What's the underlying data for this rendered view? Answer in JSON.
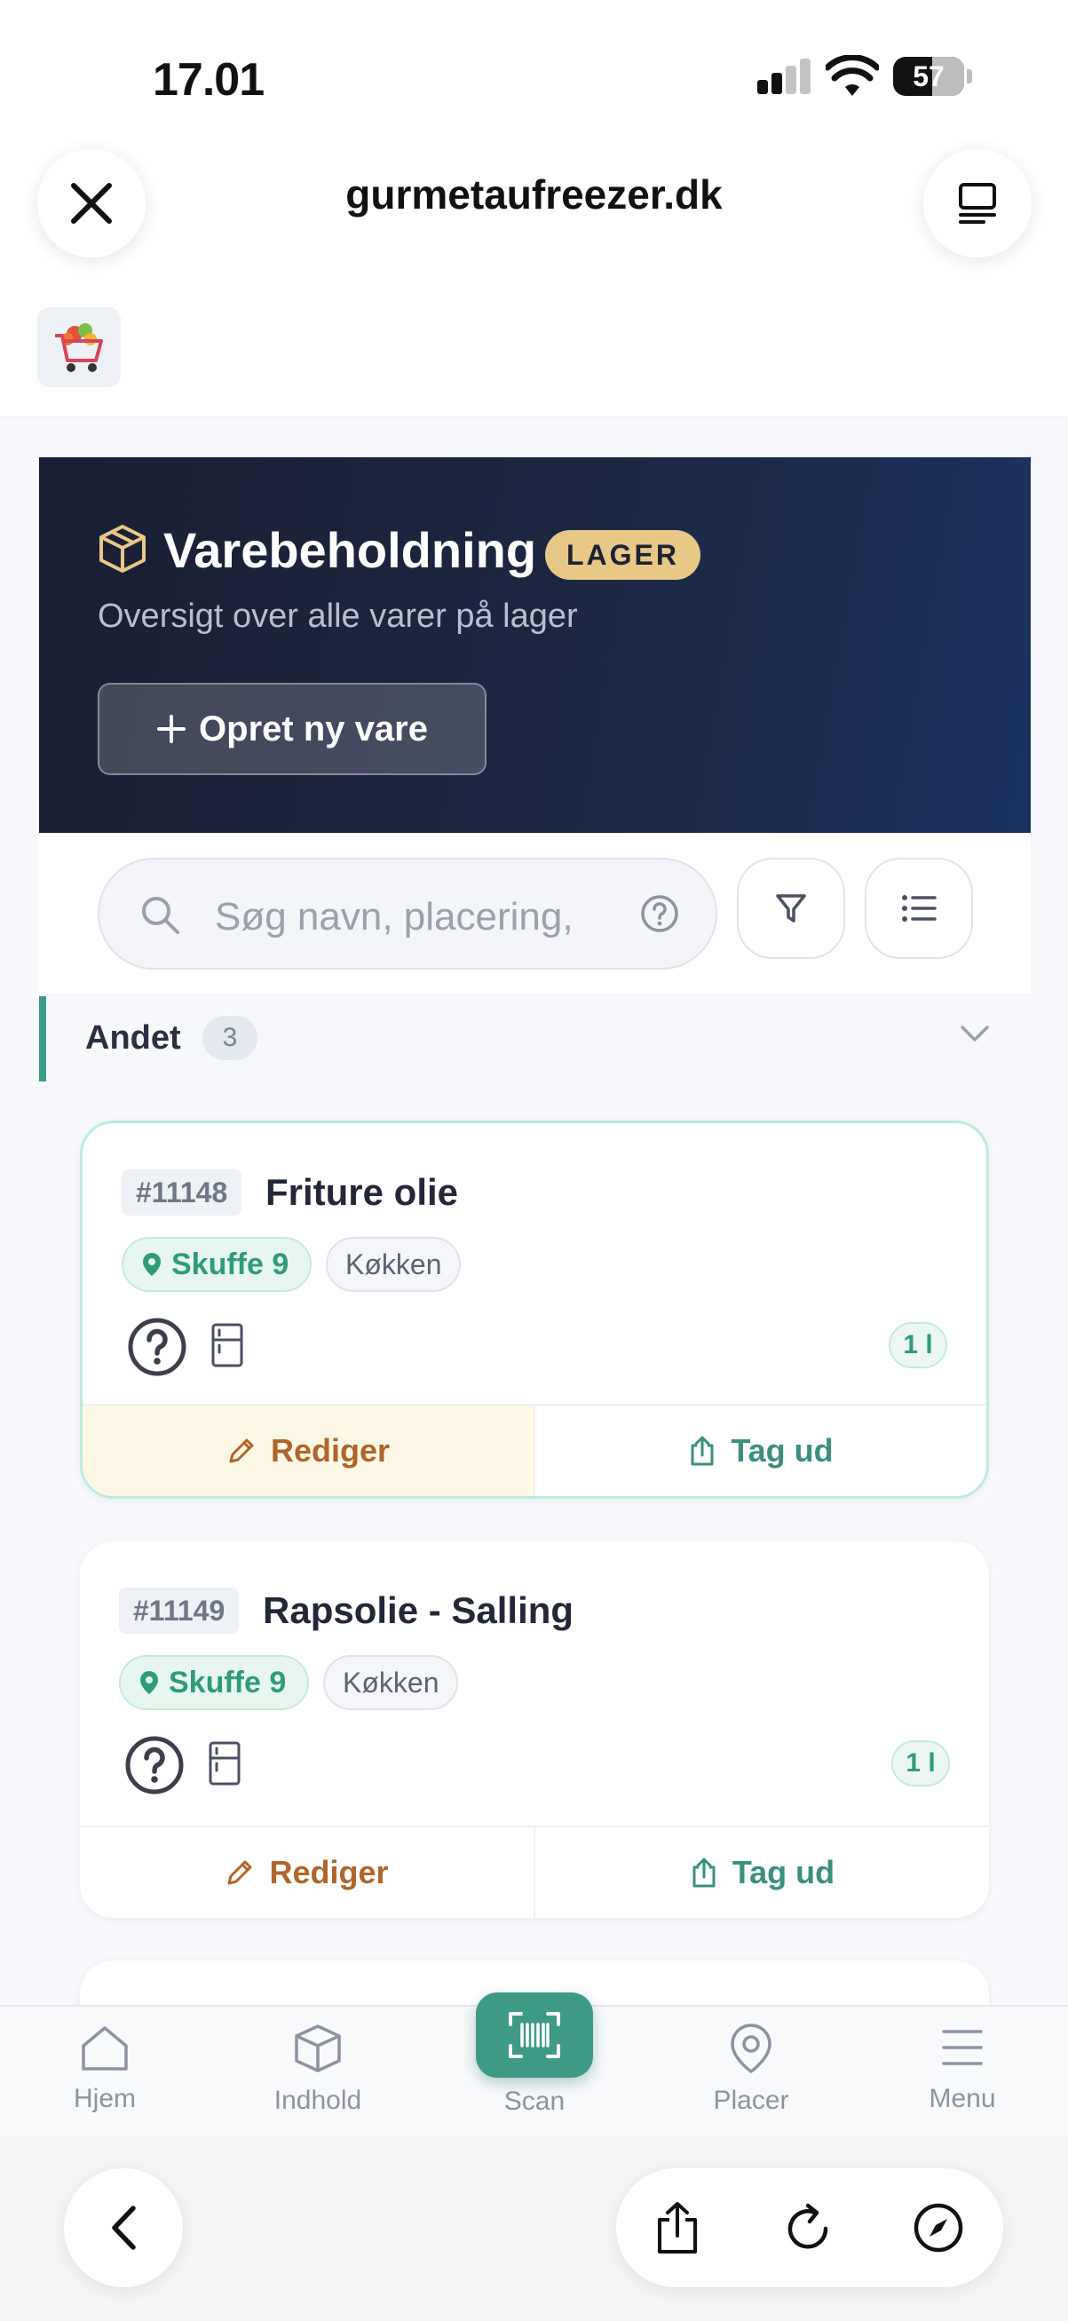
{
  "status_bar": {
    "time": "17.01",
    "battery": "57"
  },
  "browser": {
    "url": "gurmetaufreezer.dk"
  },
  "hero": {
    "title": "Varebeholdning",
    "badge": "LAGER",
    "subtitle": "Oversigt over alle varer på lager",
    "create_button": "Opret ny vare"
  },
  "search": {
    "placeholder": "Søg navn, placering,"
  },
  "category": {
    "name": "Andet",
    "count": "3"
  },
  "items": [
    {
      "id": "#11148",
      "name": "Friture olie",
      "location": "Skuffe 9",
      "room": "Køkken",
      "quantity": "1 l",
      "edit_label": "Rediger",
      "take_label": "Tag ud"
    },
    {
      "id": "#11149",
      "name": "Rapsolie - Salling",
      "location": "Skuffe 9",
      "room": "Køkken",
      "quantity": "1 l",
      "edit_label": "Rediger",
      "take_label": "Tag ud"
    }
  ],
  "nav": {
    "home": "Hjem",
    "contents": "Indhold",
    "scan": "Scan",
    "place": "Placer",
    "menu": "Menu"
  }
}
